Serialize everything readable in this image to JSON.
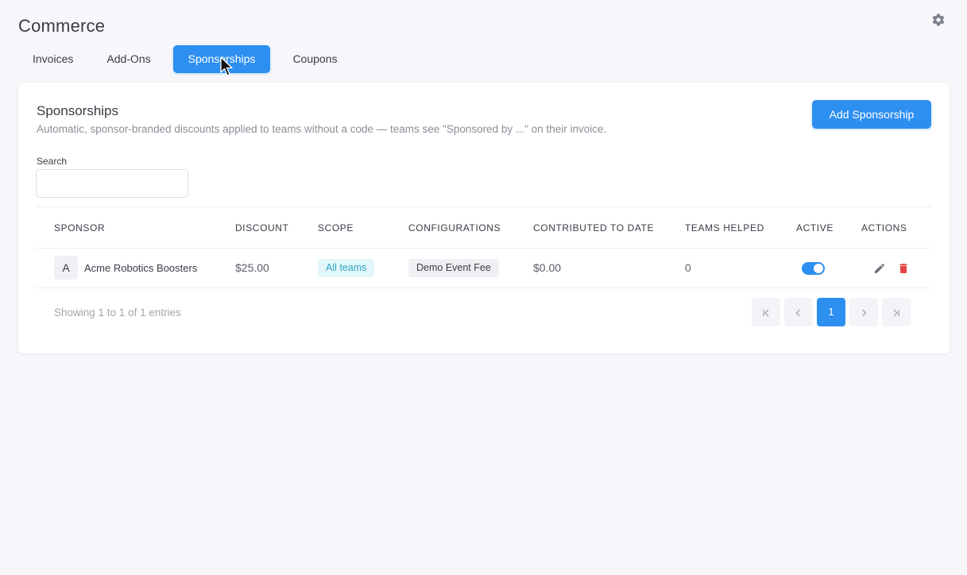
{
  "app": {
    "title": "Commerce"
  },
  "tabs": [
    {
      "label": "Invoices"
    },
    {
      "label": "Add-Ons"
    },
    {
      "label": "Sponsorships"
    },
    {
      "label": "Coupons"
    }
  ],
  "active_tab": "Sponsorships",
  "card": {
    "title": "Sponsorships",
    "subtitle": "Automatic, sponsor-branded discounts applied to teams without a code — teams see \"Sponsored by ...\" on their invoice.",
    "add_button": "Add Sponsorship"
  },
  "search": {
    "label": "Search",
    "value": "",
    "placeholder": ""
  },
  "table": {
    "columns": [
      "SPONSOR",
      "DISCOUNT",
      "SCOPE",
      "CONFIGURATIONS",
      "CONTRIBUTED TO DATE",
      "TEAMS HELPED",
      "ACTIVE",
      "ACTIONS"
    ],
    "rows": [
      {
        "avatar": "A",
        "sponsor": "Acme Robotics Boosters",
        "discount": "$25.00",
        "scope": "All teams",
        "configuration": "Demo Event Fee",
        "contributed": "$0.00",
        "teams_helped": "0",
        "active": true
      }
    ]
  },
  "footer": {
    "showing": "Showing 1 to 1 of 1 entries"
  },
  "pagination": {
    "first": "|<",
    "prev": "<",
    "current": "1",
    "next": ">",
    "last": ">|"
  },
  "colors": {
    "accent": "#2d8ff0",
    "scope_badge_bg": "#e3f6f9",
    "scope_badge_text": "#30a6c4",
    "delete": "#e64545"
  },
  "icons": {
    "settings": "gear-icon",
    "edit": "pencil-icon",
    "delete": "trash-icon",
    "cursor": "mouse-pointer-icon"
  }
}
